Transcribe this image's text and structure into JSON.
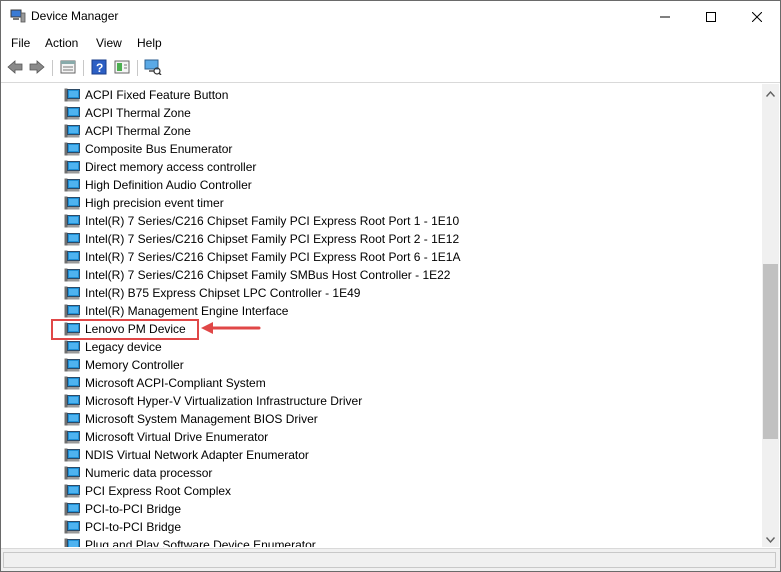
{
  "window": {
    "title": "Device Manager",
    "minimize_icon": "minimize-icon",
    "maximize_icon": "maximize-icon",
    "close_icon": "close-icon"
  },
  "menu": {
    "file": "File",
    "action": "Action",
    "view": "View",
    "help": "Help"
  },
  "toolbar": {
    "icons": [
      "back-arrow-icon",
      "forward-arrow-icon",
      "properties-icon",
      "help-icon",
      "update-driver-icon",
      "scan-hardware-icon"
    ]
  },
  "tree": {
    "devices": [
      "ACPI Fixed Feature Button",
      "ACPI Thermal Zone",
      "ACPI Thermal Zone",
      "Composite Bus Enumerator",
      "Direct memory access controller",
      "High Definition Audio Controller",
      "High precision event timer",
      "Intel(R) 7 Series/C216 Chipset Family PCI Express Root Port 1 - 1E10",
      "Intel(R) 7 Series/C216 Chipset Family PCI Express Root Port 2 - 1E12",
      "Intel(R) 7 Series/C216 Chipset Family PCI Express Root Port 6 - 1E1A",
      "Intel(R) 7 Series/C216 Chipset Family SMBus Host Controller - 1E22",
      "Intel(R) B75 Express Chipset LPC Controller - 1E49",
      "Intel(R) Management Engine Interface",
      "Lenovo PM Device",
      "Legacy device",
      "Memory Controller",
      "Microsoft ACPI-Compliant System",
      "Microsoft Hyper-V Virtualization Infrastructure Driver",
      "Microsoft System Management BIOS Driver",
      "Microsoft Virtual Drive Enumerator",
      "NDIS Virtual Network Adapter Enumerator",
      "Numeric data processor",
      "PCI Express Root Complex",
      "PCI-to-PCI Bridge",
      "PCI-to-PCI Bridge",
      "Plug and Play Software Device Enumerator"
    ],
    "highlighted": "Lenovo PM Device"
  },
  "colors": {
    "highlight": "#e04747",
    "device_icon": "#1e90d6"
  }
}
